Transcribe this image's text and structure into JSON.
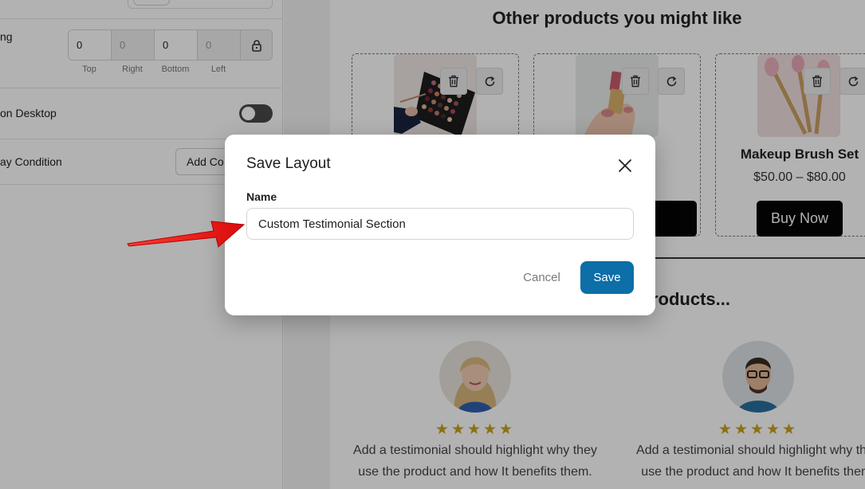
{
  "settings_panel": {
    "spacing": {
      "label": "ng",
      "values": [
        "0",
        "0",
        "0",
        "0"
      ],
      "captions": [
        "Top",
        "Right",
        "Bottom",
        "Left"
      ]
    },
    "hide_desktop": {
      "label": "on Desktop",
      "enabled": false
    },
    "display_condition": {
      "label": "ay Condition",
      "button_label": "Add Co"
    }
  },
  "canvas": {
    "products_section_title": "Other products you might like",
    "products": [
      {
        "name": "",
        "price": "",
        "buy_label": ""
      },
      {
        "name": "",
        "price": "",
        "buy_label": ""
      },
      {
        "name": "Makeup Brush Set",
        "price": "$50.00 – $80.00",
        "buy_label": "Buy Now"
      }
    ],
    "testimonials_section_title": "our products...",
    "testimonials": [
      {
        "rating": 5,
        "stars": "★★★★★",
        "line1": "Add a testimonial should highlight why they",
        "line2": "use the product and how It benefits them."
      },
      {
        "rating": 5,
        "stars": "★★★★★",
        "line1": "Add a testimonial should highlight why they",
        "line2": "use the product and how It benefits them."
      }
    ]
  },
  "modal": {
    "title": "Save Layout",
    "name_label": "Name",
    "name_value": "Custom Testimonial Section",
    "cancel_label": "Cancel",
    "save_label": "Save"
  },
  "colors": {
    "primary_button": "#0d6ea8",
    "annotation_arrow": "#e8110f",
    "star": "#c8a21a"
  },
  "icons": {
    "modal_close": "close-icon",
    "card_delete": "trash-icon",
    "card_refresh": "refresh-icon",
    "spacing_lock": "lock-icon"
  }
}
